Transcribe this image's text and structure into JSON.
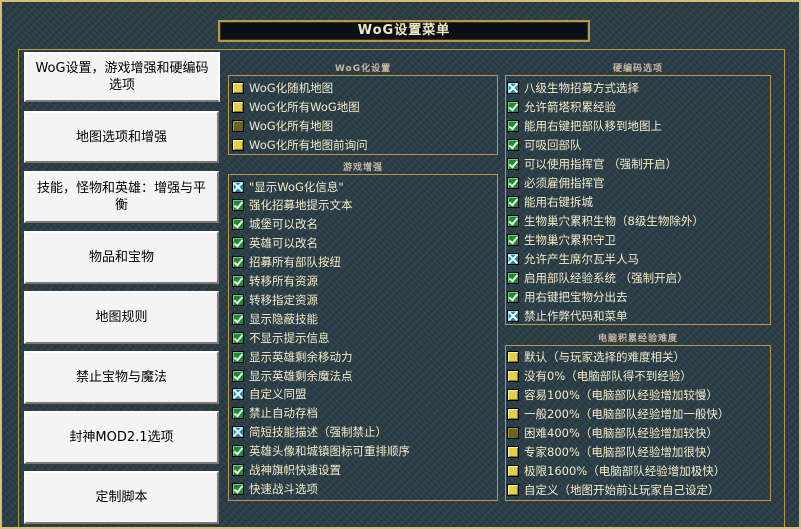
{
  "window": {
    "title": "WoG设置菜单"
  },
  "tabs": [
    {
      "label": "WoG设置，游戏增强和硬编码选项"
    },
    {
      "label": "地图选项和增强"
    },
    {
      "label": "技能，怪物和英雄：增强与平衡"
    },
    {
      "label": "物品和宝物"
    },
    {
      "label": "地图规则"
    },
    {
      "label": "禁止宝物与魔法"
    },
    {
      "label": "封神MOD2.1选项"
    },
    {
      "label": "定制脚本"
    }
  ],
  "wog_settings": {
    "title": "WoG化设置",
    "options": [
      {
        "label": "WoG化随机地图",
        "state": "yellow"
      },
      {
        "label": "WoG化所有WoG地图",
        "state": "yellow"
      },
      {
        "label": "WoG化所有地图",
        "state": "dark"
      },
      {
        "label": "WoG化所有地图前询问",
        "state": "yellow"
      }
    ]
  },
  "game_enhance": {
    "title": "游戏增强",
    "options": [
      {
        "label": "\"显示WoG化信息\"",
        "state": "cross"
      },
      {
        "label": "强化招募地提示文本",
        "state": "green"
      },
      {
        "label": "城堡可以改名",
        "state": "green"
      },
      {
        "label": "英雄可以改名",
        "state": "green"
      },
      {
        "label": "招募所有部队按纽",
        "state": "green"
      },
      {
        "label": "转移所有资源",
        "state": "green"
      },
      {
        "label": "转移指定资源",
        "state": "green"
      },
      {
        "label": "显示隐蔽技能",
        "state": "green"
      },
      {
        "label": "不显示提示信息",
        "state": "green"
      },
      {
        "label": "显示英雄剩余移动力",
        "state": "green"
      },
      {
        "label": "显示英雄剩余魔法点",
        "state": "green"
      },
      {
        "label": "自定义同盟",
        "state": "cross"
      },
      {
        "label": "禁止自动存档",
        "state": "green"
      },
      {
        "label": "简短技能描述（强制禁止）",
        "state": "cross"
      },
      {
        "label": "英雄头像和城镇图标可重排顺序",
        "state": "green"
      },
      {
        "label": "战神旗帜快速设置",
        "state": "green"
      },
      {
        "label": "快速战斗选项",
        "state": "green"
      }
    ]
  },
  "hardcode": {
    "title": "硬编码选项",
    "options": [
      {
        "label": "八级生物招募方式选择",
        "state": "cross"
      },
      {
        "label": "允许箭塔积累经验",
        "state": "green"
      },
      {
        "label": "能用右键把部队移到地图上",
        "state": "green"
      },
      {
        "label": "可吸回部队",
        "state": "green"
      },
      {
        "label": "可以使用指挥官 （强制开启）",
        "state": "green"
      },
      {
        "label": "必须雇佣指挥官",
        "state": "green"
      },
      {
        "label": "能用右键拆城",
        "state": "green"
      },
      {
        "label": "生物巢穴累积生物（8级生物除外）",
        "state": "green"
      },
      {
        "label": "生物巢穴累积守卫",
        "state": "green"
      },
      {
        "label": "允许产生席尔瓦半人马",
        "state": "cross"
      },
      {
        "label": "启用部队经验系统 （强制开启）",
        "state": "green"
      },
      {
        "label": "用右键把宝物分出去",
        "state": "green"
      },
      {
        "label": "禁止作弊代码和菜单",
        "state": "cross"
      }
    ]
  },
  "ai_exp": {
    "title": "电脑积累经验难度",
    "options": [
      {
        "label": "默认（与玩家选择的难度相关）",
        "state": "yellow"
      },
      {
        "label": "没有0%（电脑部队得不到经验）",
        "state": "yellow"
      },
      {
        "label": "容易100%（电脑部队经验增加较慢）",
        "state": "yellow"
      },
      {
        "label": "一般200%（电脑部队经验增加一般快）",
        "state": "yellow"
      },
      {
        "label": "困难400%（电脑部队经验增加较快）",
        "state": "dark"
      },
      {
        "label": "专家800%（电脑部队经验增加很快）",
        "state": "yellow"
      },
      {
        "label": "极限1600%（电脑部队经验增加极快）",
        "state": "yellow"
      },
      {
        "label": "自定义（地图开始前让玩家自己设定）",
        "state": "yellow"
      }
    ]
  }
}
